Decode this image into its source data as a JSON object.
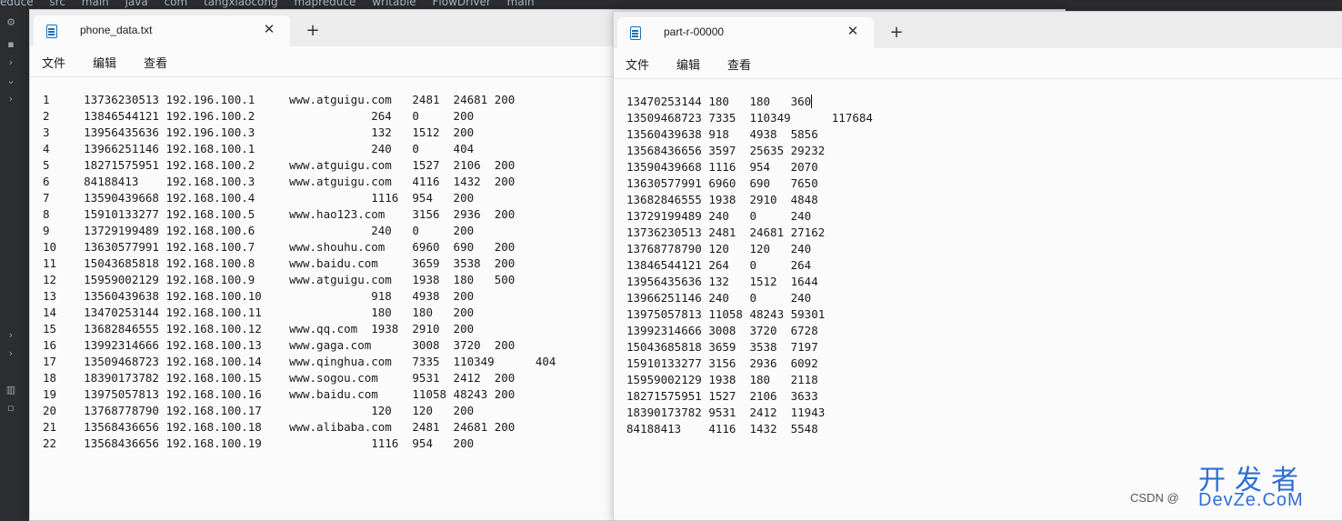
{
  "ide": {
    "breadcrumb": [
      "educe",
      "src",
      "main",
      "java",
      "com",
      "tangxiaocong",
      "mapreduce",
      "writable",
      "FlowDriver",
      "main"
    ]
  },
  "left_window": {
    "tab_title": "phone_data.txt",
    "menu": [
      "文件",
      "编辑",
      "查看"
    ],
    "content": "1\t13736230513\t192.196.100.1\twww.atguigu.com\t2481\t24681\t200\n2\t13846544121\t192.196.100.2\t\t\t264\t0\t200\n3 \t13956435636\t192.196.100.3\t\t\t132\t1512\t200\n4 \t13966251146\t192.168.100.1\t\t\t240\t0\t404\n5 \t18271575951\t192.168.100.2\twww.atguigu.com\t1527\t2106\t200\n6 \t84188413\t192.168.100.3\twww.atguigu.com\t4116\t1432\t200\n7 \t13590439668\t192.168.100.4\t\t\t1116\t954\t200\n8 \t15910133277\t192.168.100.5\twww.hao123.com\t3156\t2936\t200\n9 \t13729199489\t192.168.100.6\t\t\t240\t0\t200\n10 \t13630577991\t192.168.100.7\twww.shouhu.com\t6960\t690\t200\n11 \t15043685818\t192.168.100.8\twww.baidu.com\t3659\t3538\t200\n12 \t15959002129\t192.168.100.9\twww.atguigu.com\t1938\t180\t500\n13 \t13560439638\t192.168.100.10\t\t\t918\t4938\t200\n14 \t13470253144\t192.168.100.11\t\t\t180\t180\t200\n15 \t13682846555\t192.168.100.12\twww.qq.com\t1938\t2910\t200\n16 \t13992314666\t192.168.100.13\twww.gaga.com\t3008\t3720\t200\n17 \t13509468723\t192.168.100.14\twww.qinghua.com\t7335\t110349\t404\n18 \t18390173782\t192.168.100.15\twww.sogou.com\t9531\t2412\t200\n19 \t13975057813\t192.168.100.16\twww.baidu.com\t11058\t48243\t200\n20 \t13768778790\t192.168.100.17\t\t\t120\t120\t200\n21 \t13568436656\t192.168.100.18\twww.alibaba.com\t2481\t24681\t200\n22 \t13568436656\t192.168.100.19\t\t\t1116\t954\t200"
  },
  "right_window": {
    "tab_title": "part-r-00000",
    "menu": [
      "文件",
      "编辑",
      "查看"
    ],
    "first_line": "13470253144\t180\t180\t360",
    "content": "13509468723\t7335\t110349\t117684\n13560439638\t918\t4938\t5856\n13568436656\t3597\t25635\t29232\n13590439668\t1116\t954\t2070\n13630577991\t6960\t690\t7650\n13682846555\t1938\t2910\t4848\n13729199489\t240\t0\t240\n13736230513\t2481\t24681\t27162\n13768778790\t120\t120\t240\n13846544121\t264\t0\t264\n13956435636\t132\t1512\t1644\n13966251146\t240\t0\t240\n13975057813\t11058\t48243\t59301\n13992314666\t3008\t3720\t6728\n15043685818\t3659\t3538\t7197\n15910133277\t3156\t2936\t6092\n15959002129\t1938\t180\t2118\n18271575951\t1527\t2106\t3633\n18390173782\t9531\t2412\t11943\n84188413\t4116\t1432\t5548"
  },
  "watermark": {
    "csdn": "CSDN @",
    "brand_cn": "开发者",
    "brand_en": "DevZe.CoM"
  }
}
